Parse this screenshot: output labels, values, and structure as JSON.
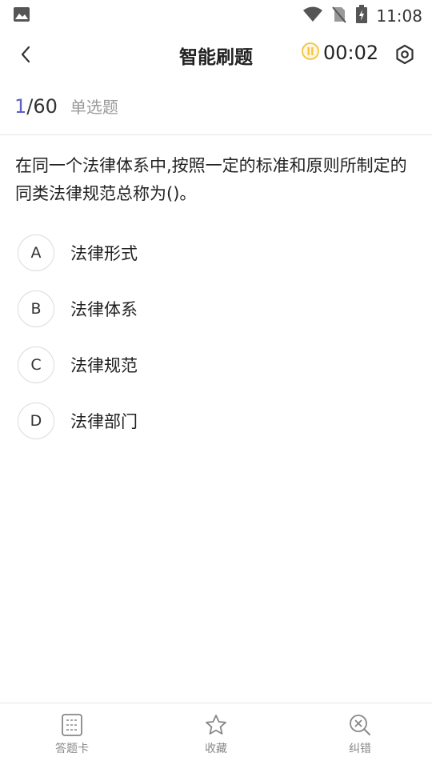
{
  "status_bar": {
    "time": "11:08"
  },
  "header": {
    "title": "智能刷题",
    "timer": "00:02"
  },
  "progress": {
    "current": "1",
    "separator": "/",
    "total": "60",
    "question_type": "单选题"
  },
  "question": {
    "text": "在同一个法律体系中,按照一定的标准和原则所制定的同类法律规范总称为()。"
  },
  "options": [
    {
      "letter": "A",
      "text": "法律形式"
    },
    {
      "letter": "B",
      "text": "法律体系"
    },
    {
      "letter": "C",
      "text": "法律规范"
    },
    {
      "letter": "D",
      "text": "法律部门"
    }
  ],
  "bottom_tabs": [
    {
      "label": "答题卡",
      "icon": "answer-card-icon"
    },
    {
      "label": "收藏",
      "icon": "star-icon"
    },
    {
      "label": "纠错",
      "icon": "error-correction-icon"
    }
  ],
  "colors": {
    "accent": "#5b5fc7",
    "timer_icon": "#f5c242",
    "muted_text": "#999999"
  }
}
